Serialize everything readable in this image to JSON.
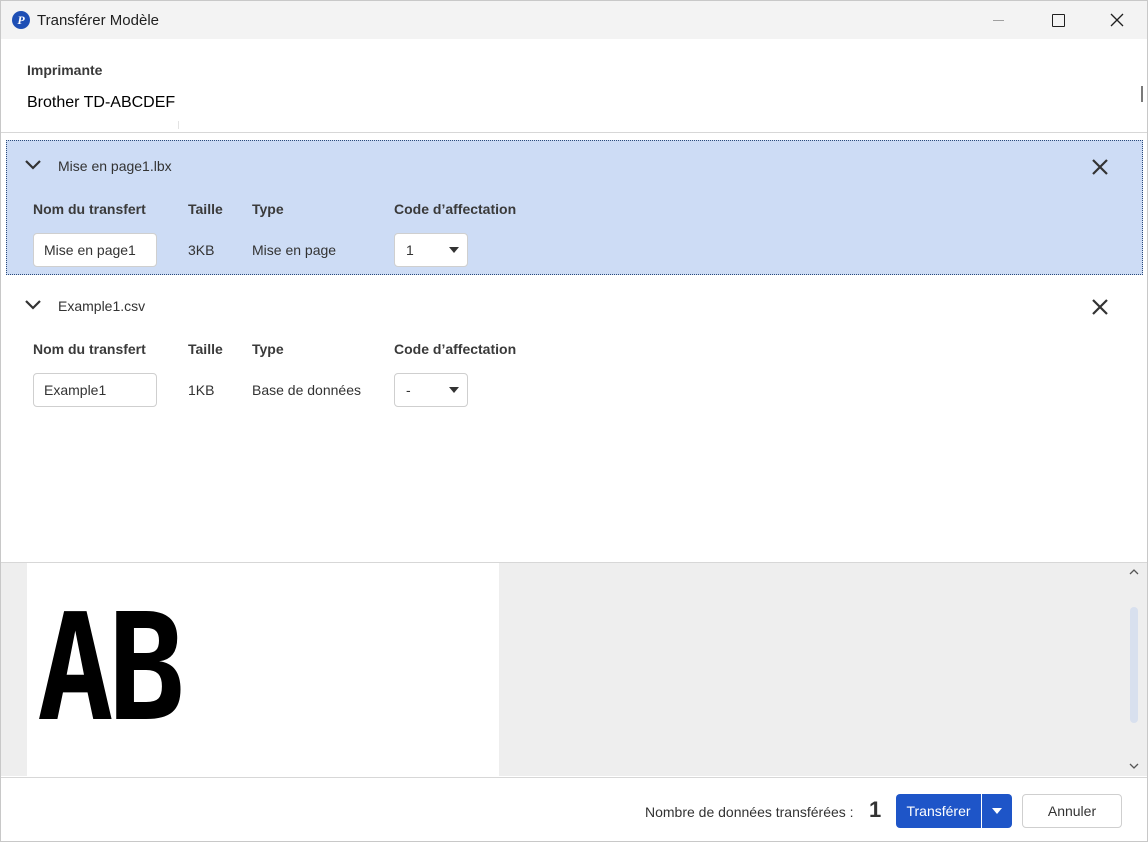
{
  "window": {
    "title": "Transférer Modèle",
    "icon_letter": "P",
    "controls": [
      "minimize-icon",
      "maximize-icon",
      "close-icon"
    ]
  },
  "printer": {
    "label": "Imprimante",
    "value": "Brother TD-ABCDEF"
  },
  "columns": {
    "name": "Nom du transfert",
    "size": "Taille",
    "type": "Type",
    "code": "Code d’affectation"
  },
  "files": [
    {
      "file": "Mise en page1.lbx",
      "transfer_name": "Mise en page1",
      "size": "3KB",
      "type": "Mise en page",
      "code": "1",
      "selected": true
    },
    {
      "file": "Example1.csv",
      "transfer_name": "Example1",
      "size": "1KB",
      "type": "Base de données",
      "code": "-",
      "selected": false
    }
  ],
  "preview": {
    "text": "AB"
  },
  "footer": {
    "count_label": "Nombre de données transférées :",
    "count_value": "1",
    "transfer_label": "Transférer",
    "cancel_label": "Annuler"
  },
  "colors": {
    "accent": "#1e55c8",
    "selected_row": "#cddcf5",
    "preview_bg": "#eeeeee"
  }
}
